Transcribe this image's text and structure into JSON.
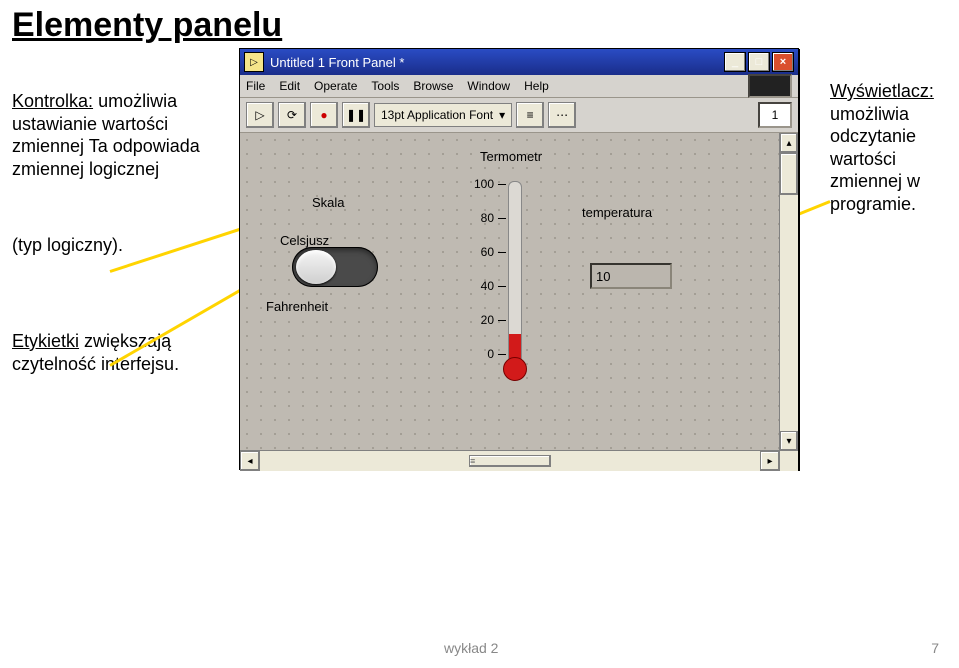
{
  "page": {
    "title": "Elementy panelu",
    "footer_left": "wykład 2",
    "footer_right": "7"
  },
  "kontrolka": {
    "label": "Kontrolka:",
    "text": "umożliwia ustawianie wartości zmiennej Ta odpowiada zmiennej logicznej"
  },
  "typ_logiczny": "(typ logiczny).",
  "etykietki": {
    "label": "Etykietki",
    "text": "zwiększają czytelność interfejsu."
  },
  "wyswietlacz": {
    "label": "Wyświetlacz:",
    "text": "umożliwia odczytanie wartości zmiennej w programie."
  },
  "window": {
    "title": "Untitled 1 Front Panel *",
    "menu": [
      "File",
      "Edit",
      "Operate",
      "Tools",
      "Browse",
      "Window",
      "Help"
    ],
    "toolbar": {
      "font_label": "13pt Application Font",
      "number_box": "1"
    },
    "canvas": {
      "skala_label": "Skala",
      "celsjusz_label": "Celsjusz",
      "fahrenheit_label": "Fahrenheit",
      "termometr_label": "Termometr",
      "temperatura_label": "temperatura",
      "ticks": {
        "t100": "100",
        "t80": "80",
        "t60": "60",
        "t40": "40",
        "t20": "20",
        "t0": "0"
      },
      "numeric_value": "10"
    },
    "app_icon_glyph": "▷"
  }
}
